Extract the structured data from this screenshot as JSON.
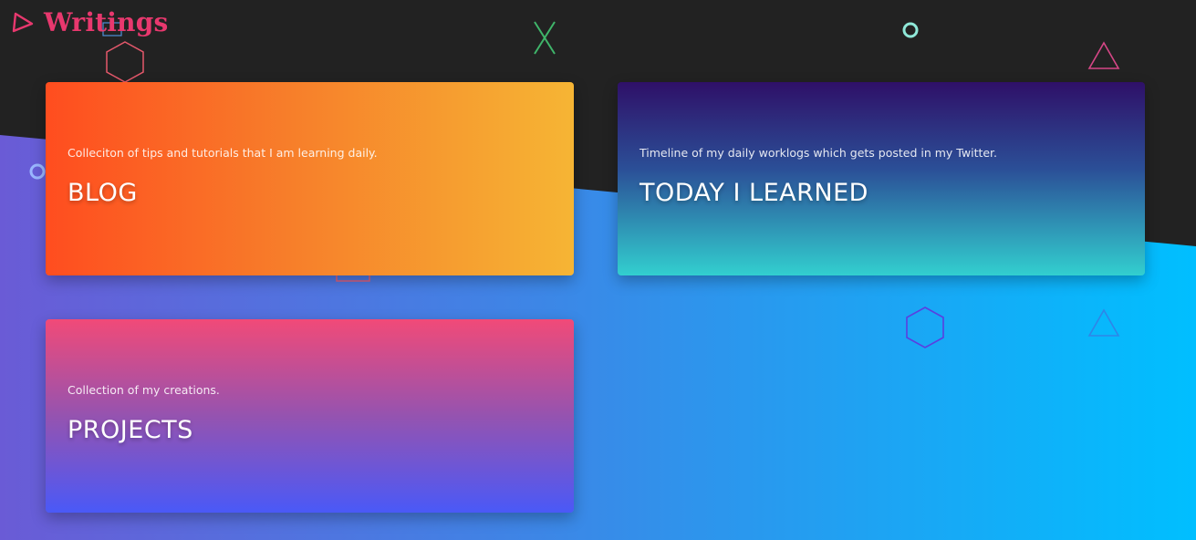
{
  "header": {
    "title": "Writings"
  },
  "cards": [
    {
      "id": "blog",
      "description": "Colleciton of tips and tutorials that I am learning daily.",
      "title": "BLOG"
    },
    {
      "id": "today-i-learned",
      "description": "Timeline of my daily worklogs which gets posted in my Twitter.",
      "title": "TODAY I LEARNED"
    },
    {
      "id": "projects",
      "description": "Collection of my creations.",
      "title": "PROJECTS"
    }
  ],
  "colors": {
    "background_dark": "#222222",
    "wave_left": "#6a5bd6",
    "wave_right": "#00bfff",
    "brand": "#e8386e"
  },
  "decorations": [
    "triangle-icon",
    "hexagon-icon",
    "square-icon",
    "cross-icon",
    "circle-icon"
  ]
}
